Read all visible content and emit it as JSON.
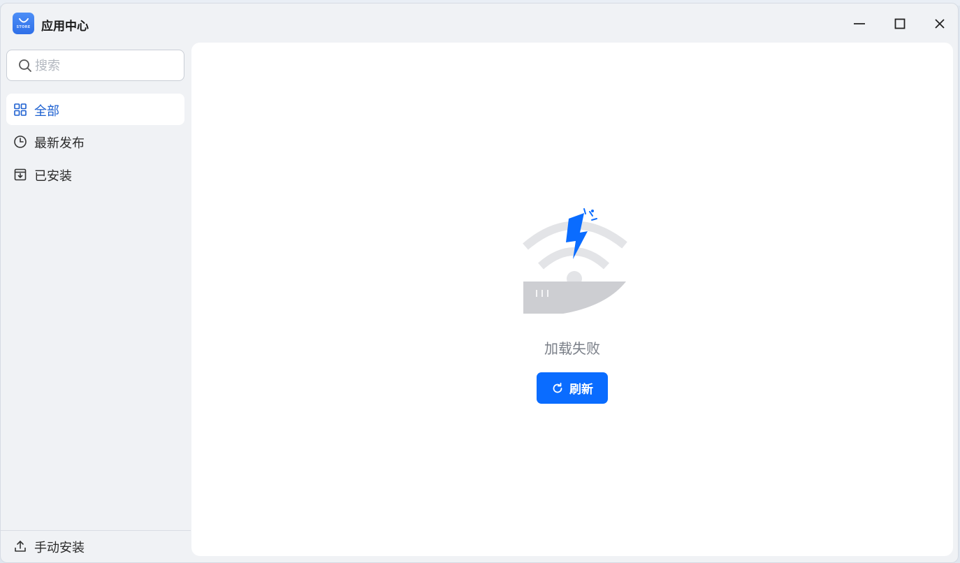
{
  "window": {
    "title": "应用中心",
    "logo_text": "STORE",
    "controls": [
      "minimize-icon",
      "maximize-icon",
      "close-icon"
    ]
  },
  "sidebar": {
    "search": {
      "placeholder": "搜索",
      "value": ""
    },
    "items": [
      {
        "label": "全部",
        "icon": "grid-icon",
        "active": true
      },
      {
        "label": "最新发布",
        "icon": "clock-icon",
        "active": false
      },
      {
        "label": "已安装",
        "icon": "installed-box-icon",
        "active": false
      }
    ],
    "footer": {
      "label": "手动安装",
      "icon": "upload-icon"
    }
  },
  "main": {
    "status_text": "加载失败",
    "illustration": "network-error-icon",
    "refresh_button": {
      "label": "刷新",
      "icon": "refresh-icon"
    }
  },
  "colors": {
    "accent": "#0a6cff",
    "active_text": "#1b5fd0",
    "sidebar_bg": "#f0f2f5",
    "content_bg": "#ffffff"
  }
}
